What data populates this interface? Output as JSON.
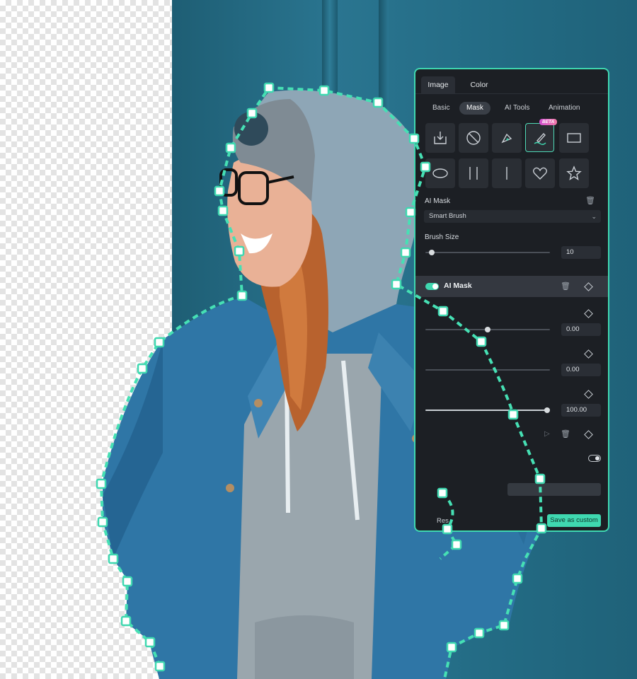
{
  "panel": {
    "tabs": [
      {
        "label": "Image"
      },
      {
        "label": "Color"
      }
    ],
    "subtabs": [
      {
        "label": "Basic"
      },
      {
        "label": "Mask"
      },
      {
        "label": "AI Tools"
      },
      {
        "label": "Animation"
      }
    ],
    "active_subtab": "Mask",
    "tools": [
      "import-icon",
      "no-mask-icon",
      "pen-icon",
      "smart-brush-icon",
      "rectangle-icon",
      "ellipse-icon",
      "double-line-icon",
      "single-line-icon",
      "heart-icon",
      "star-icon"
    ],
    "beta_badge": "BETA",
    "ai_mask_title": "AI Mask",
    "ai_mask_select": "Smart Brush",
    "brush_size_label": "Brush Size",
    "brush_size_value": "10",
    "brush_size_fraction": 0.05,
    "mask_item_label": "AI Mask",
    "mask_item_enabled": true,
    "fields": [
      {
        "value": "0.00"
      },
      {
        "value": "0.00"
      },
      {
        "value": "100.00"
      }
    ],
    "reset_label": "Res",
    "save_label": "Save as custom",
    "accent_color": "#3fd8b0"
  }
}
